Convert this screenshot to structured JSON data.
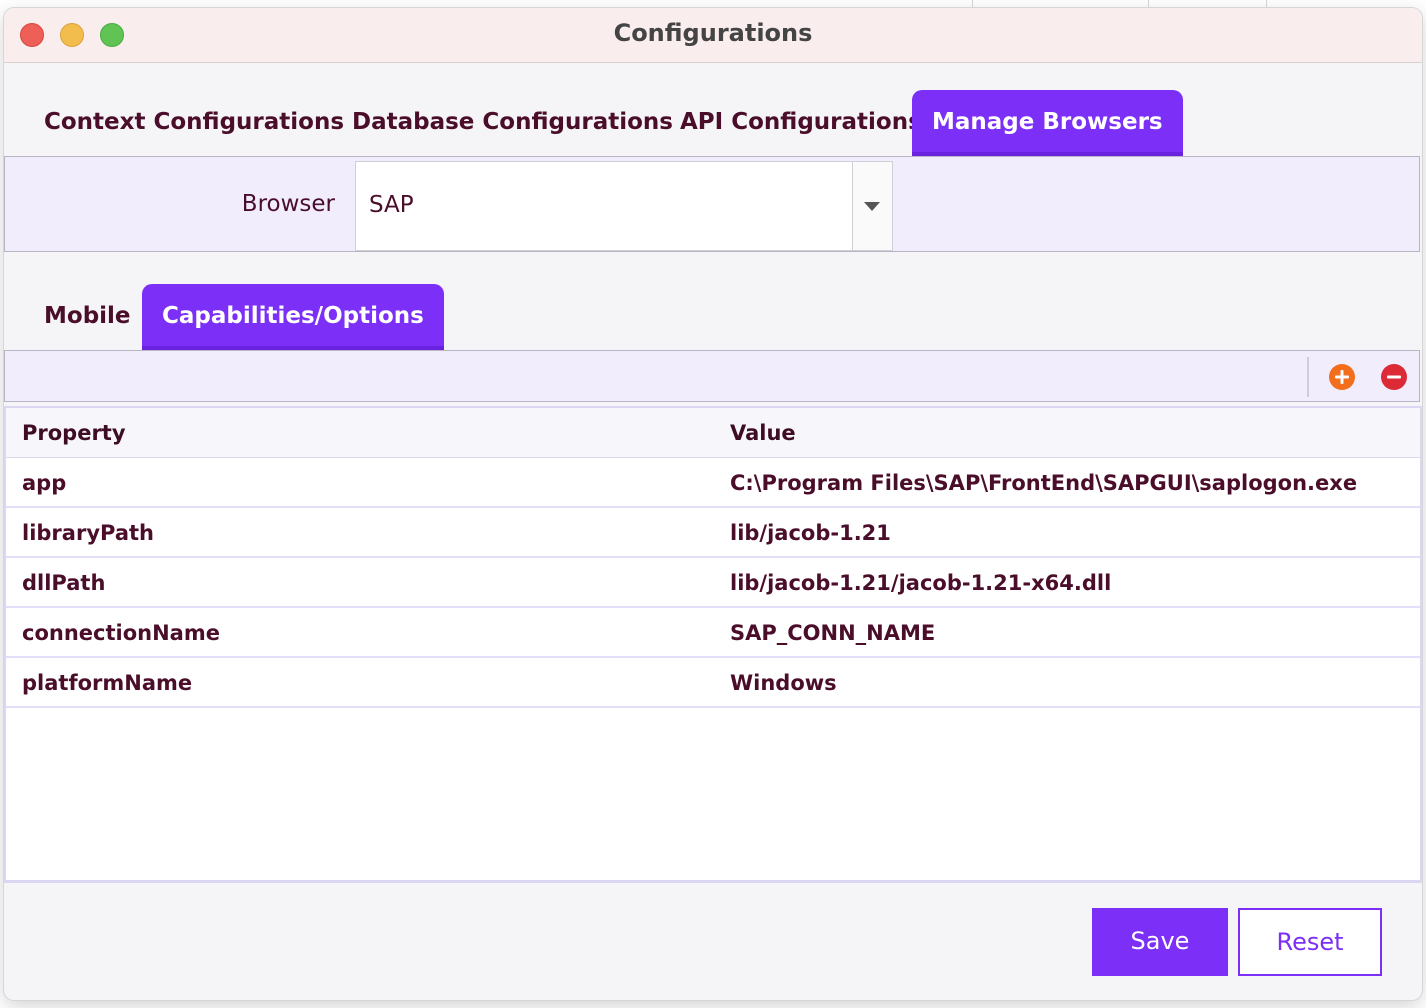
{
  "window": {
    "title": "Configurations"
  },
  "main_tabs": [
    {
      "label": "Context Configurations",
      "active": false
    },
    {
      "label": "Database Configurations",
      "active": false
    },
    {
      "label": "API Configurations",
      "active": false
    },
    {
      "label": "Manage Browsers",
      "active": true
    }
  ],
  "browser": {
    "label": "Browser",
    "selected": "SAP"
  },
  "sub_tabs": [
    {
      "label": "Mobile",
      "active": false
    },
    {
      "label": "Capabilities/Options",
      "active": true
    }
  ],
  "toolbar": {
    "add_icon": "plus-circle-icon",
    "remove_icon": "minus-circle-icon"
  },
  "table": {
    "headers": [
      "Property",
      "Value"
    ],
    "rows": [
      {
        "property": "app",
        "value": "C:\\Program Files\\SAP\\FrontEnd\\SAPGUI\\saplogon.exe"
      },
      {
        "property": "libraryPath",
        "value": "lib/jacob-1.21"
      },
      {
        "property": "dllPath",
        "value": "lib/jacob-1.21/jacob-1.21-x64.dll"
      },
      {
        "property": "connectionName",
        "value": "SAP_CONN_NAME"
      },
      {
        "property": "platformName",
        "value": "Windows"
      }
    ]
  },
  "actions": {
    "save_label": "Save",
    "reset_label": "Reset"
  },
  "colors": {
    "accent": "#7b2ff7",
    "text": "#4a0e2a",
    "add_button": "#f26d1c",
    "remove_button": "#dc2a37"
  }
}
